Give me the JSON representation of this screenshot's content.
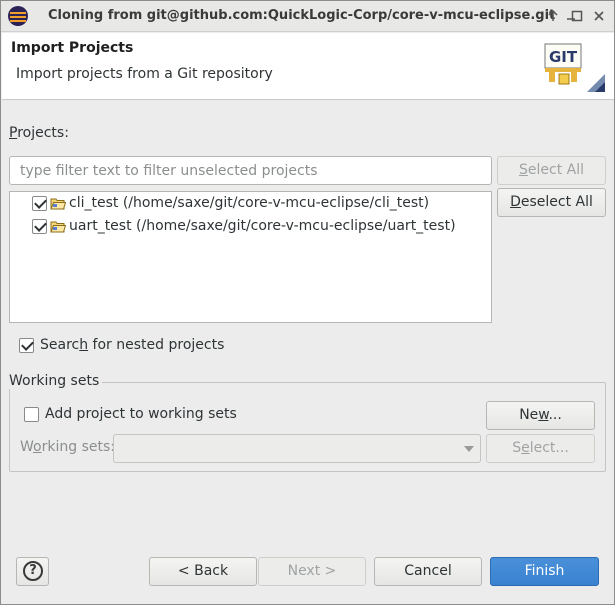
{
  "window": {
    "title": "Cloning from git@github.com:QuickLogic-Corp/core-v-mcu-eclipse.git"
  },
  "header": {
    "title": "Import Projects",
    "description": "Import projects from a Git repository",
    "logo_text": "GIT"
  },
  "projects": {
    "label_underlined": "P",
    "label_rest": "rojects:",
    "filter_placeholder": "type filter text to filter unselected projects",
    "filter_value": "",
    "select_all_pre": "",
    "select_all_u": "S",
    "select_all_post": "elect All",
    "deselect_all_pre": "",
    "deselect_all_u": "D",
    "deselect_all_post": "eselect All",
    "items": [
      {
        "label": "cli_test (/home/saxe/git/core-v-mcu-eclipse/cli_test)",
        "checked": true
      },
      {
        "label": "uart_test (/home/saxe/git/core-v-mcu-eclipse/uart_test)",
        "checked": true
      }
    ]
  },
  "nested": {
    "label_pre": "Searc",
    "label_u": "h",
    "label_post": " for nested projects",
    "checked": true
  },
  "working_sets": {
    "group_title": "Working sets",
    "add_label": "Add project to working sets",
    "add_checked": false,
    "new_pre": "Ne",
    "new_u": "w",
    "new_post": "...",
    "sets_label_pre": "W",
    "sets_label_u": "o",
    "sets_label_post": "rking sets:",
    "select_pre": "S",
    "select_u": "e",
    "select_post": "lect..."
  },
  "footer": {
    "help_symbol": "?",
    "back_label": "< Back",
    "next_label": "Next >",
    "cancel_label": "Cancel",
    "finish_label": "Finish"
  },
  "colors": {
    "accent": "#4a90d9",
    "eclipse_orange": "#f0a028",
    "eclipse_purple": "#2c2255"
  }
}
